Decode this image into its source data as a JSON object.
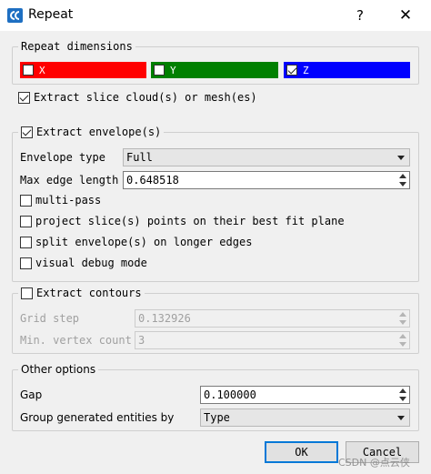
{
  "window": {
    "title": "Repeat",
    "help_glyph": "?",
    "close_glyph": "✕"
  },
  "repeat_dimensions": {
    "title": "Repeat dimensions",
    "items": [
      {
        "label": "X",
        "checked": false,
        "color": "#ff0000"
      },
      {
        "label": "Y",
        "checked": false,
        "color": "#008000"
      },
      {
        "label": "Z",
        "checked": true,
        "color": "#0000ff"
      }
    ]
  },
  "extract_slice": {
    "label": "Extract slice cloud(s) or mesh(es)",
    "checked": true
  },
  "extract_envelope": {
    "label": "Extract envelope(s)",
    "checked": true,
    "envelope_type_label": "Envelope type",
    "envelope_type_value": "Full",
    "max_edge_label": "Max edge length",
    "max_edge_value": "0.648518",
    "options": [
      {
        "label": "multi-pass",
        "checked": false
      },
      {
        "label": "project slice(s) points on their best fit plane",
        "checked": false
      },
      {
        "label": "split envelope(s) on longer edges",
        "checked": false
      },
      {
        "label": "visual debug mode",
        "checked": false
      }
    ]
  },
  "extract_contours": {
    "label": "Extract contours",
    "checked": false,
    "grid_step_label": "Grid step",
    "grid_step_value": "0.132926",
    "min_vertex_label": "Min. vertex count",
    "min_vertex_value": "3"
  },
  "other_options": {
    "title": "Other options",
    "gap_label": "Gap",
    "gap_value": "0.100000",
    "group_by_label": "Group generated entities by",
    "group_by_value": "Type"
  },
  "buttons": {
    "ok": "OK",
    "cancel": "Cancel"
  },
  "watermark": "CSDN @点云侠",
  "colors": {
    "accent": "#0078d7",
    "icon": "#1e6fc2"
  }
}
